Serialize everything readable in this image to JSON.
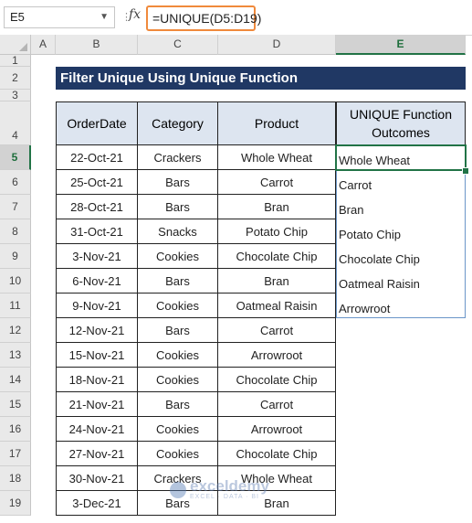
{
  "formula_bar": {
    "name_box": "E5",
    "fx_label": "fx",
    "formula": "=UNIQUE(D5:D19)"
  },
  "columns": [
    "A",
    "B",
    "C",
    "D",
    "E"
  ],
  "rows": [
    "1",
    "2",
    "3",
    "4",
    "5",
    "6",
    "7",
    "8",
    "9",
    "10",
    "11",
    "12",
    "13",
    "14",
    "15",
    "16",
    "17",
    "18",
    "19"
  ],
  "title": "Filter Unique Using Unique Function",
  "table": {
    "headers": [
      "OrderDate",
      "Category",
      "Product"
    ],
    "rows": [
      [
        "22-Oct-21",
        "Crackers",
        "Whole Wheat"
      ],
      [
        "25-Oct-21",
        "Bars",
        "Carrot"
      ],
      [
        "28-Oct-21",
        "Bars",
        "Bran"
      ],
      [
        "31-Oct-21",
        "Snacks",
        "Potato Chip"
      ],
      [
        "3-Nov-21",
        "Cookies",
        "Chocolate Chip"
      ],
      [
        "6-Nov-21",
        "Bars",
        "Bran"
      ],
      [
        "9-Nov-21",
        "Cookies",
        "Oatmeal Raisin"
      ],
      [
        "12-Nov-21",
        "Bars",
        "Carrot"
      ],
      [
        "15-Nov-21",
        "Cookies",
        "Arrowroot"
      ],
      [
        "18-Nov-21",
        "Cookies",
        "Chocolate Chip"
      ],
      [
        "21-Nov-21",
        "Bars",
        "Carrot"
      ],
      [
        "24-Nov-21",
        "Cookies",
        "Arrowroot"
      ],
      [
        "27-Nov-21",
        "Cookies",
        "Chocolate Chip"
      ],
      [
        "30-Nov-21",
        "Crackers",
        "Whole Wheat"
      ],
      [
        "3-Dec-21",
        "Bars",
        "Bran"
      ]
    ]
  },
  "outcome": {
    "header": "UNIQUE Function Outcomes",
    "values": [
      "Whole Wheat",
      "Carrot",
      "Bran",
      "Potato Chip",
      "Chocolate Chip",
      "Oatmeal Raisin",
      "Arrowroot"
    ]
  },
  "watermark": {
    "name": "exceldemy",
    "tagline": "EXCEL · DATA · BI"
  },
  "colors": {
    "title_bg": "#203864",
    "header_bg": "#dde5f0",
    "selection": "#217346",
    "formula_highlight": "#f08a3c"
  }
}
